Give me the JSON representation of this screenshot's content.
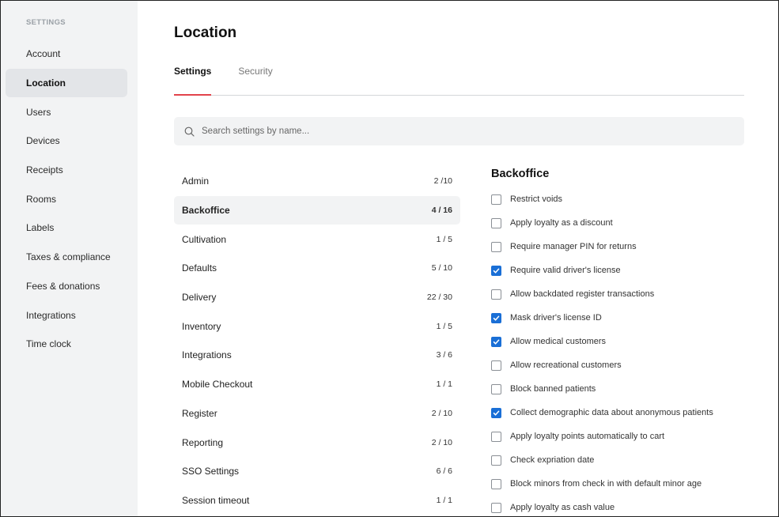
{
  "sidebar": {
    "heading": "SETTINGS",
    "items": [
      {
        "label": "Account"
      },
      {
        "label": "Location",
        "active": true
      },
      {
        "label": "Users"
      },
      {
        "label": "Devices"
      },
      {
        "label": "Receipts"
      },
      {
        "label": "Rooms"
      },
      {
        "label": "Labels"
      },
      {
        "label": "Taxes & compliance"
      },
      {
        "label": "Fees & donations"
      },
      {
        "label": "Integrations"
      },
      {
        "label": "Time clock"
      }
    ]
  },
  "page": {
    "title": "Location"
  },
  "tabs": [
    {
      "label": "Settings",
      "active": true
    },
    {
      "label": "Security"
    }
  ],
  "search": {
    "placeholder": "Search settings by name...",
    "value": "",
    "icon": "search-icon"
  },
  "categories": [
    {
      "label": "Admin",
      "count": "2 /10"
    },
    {
      "label": "Backoffice",
      "count": "4 / 16",
      "active": true
    },
    {
      "label": "Cultivation",
      "count": "1 / 5"
    },
    {
      "label": "Defaults",
      "count": "5 / 10"
    },
    {
      "label": "Delivery",
      "count": "22 / 30"
    },
    {
      "label": "Inventory",
      "count": "1 / 5"
    },
    {
      "label": "Integrations",
      "count": "3 / 6"
    },
    {
      "label": "Mobile Checkout",
      "count": "1 / 1"
    },
    {
      "label": "Register",
      "count": "2 / 10"
    },
    {
      "label": "Reporting",
      "count": "2 / 10"
    },
    {
      "label": "SSO Settings",
      "count": "6 / 6"
    },
    {
      "label": "Session timeout",
      "count": "1 / 1"
    }
  ],
  "panel": {
    "title": "Backoffice",
    "options": [
      {
        "label": "Restrict voids",
        "checked": false
      },
      {
        "label": "Apply loyalty as a discount",
        "checked": false
      },
      {
        "label": "Require manager PIN for returns",
        "checked": false
      },
      {
        "label": "Require valid driver's license",
        "checked": true
      },
      {
        "label": "Allow backdated register transactions",
        "checked": false
      },
      {
        "label": "Mask driver's license ID",
        "checked": true
      },
      {
        "label": "Allow medical customers",
        "checked": true
      },
      {
        "label": "Allow recreational customers",
        "checked": false
      },
      {
        "label": "Block banned patients",
        "checked": false
      },
      {
        "label": "Collect demographic data about anonymous patients",
        "checked": true
      },
      {
        "label": "Apply loyalty points automatically to cart",
        "checked": false
      },
      {
        "label": "Check expriation date",
        "checked": false
      },
      {
        "label": "Block minors from check in with default minor age",
        "checked": false
      },
      {
        "label": "Apply loyalty as cash value",
        "checked": false
      }
    ]
  },
  "colors": {
    "accent_tab": "#e2434b",
    "checkbox": "#1a6fd6",
    "sidebar_bg": "#f2f3f4"
  }
}
